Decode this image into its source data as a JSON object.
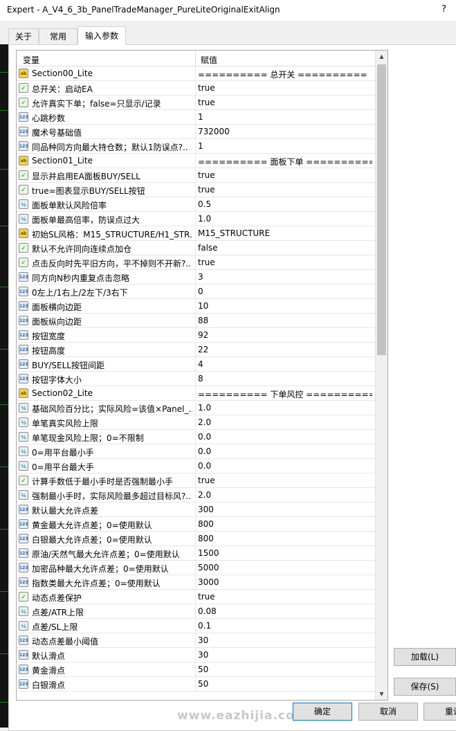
{
  "window": {
    "title": "Expert - A_V4_6_3b_PanelTradeManager_PureLiteOriginalExitAlign",
    "help": "?"
  },
  "tabs": [
    {
      "label": "关于"
    },
    {
      "label": "常用"
    },
    {
      "label": "输入参数",
      "active": true
    }
  ],
  "grid": {
    "col_variable": "变量",
    "col_value": "赋值",
    "rows": [
      {
        "type": "string",
        "icon": "ab",
        "name": "Section00_Lite",
        "value": "========== 总开关 =========="
      },
      {
        "type": "bool",
        "icon": "✓",
        "name": "总开关：启动EA",
        "value": "true"
      },
      {
        "type": "bool",
        "icon": "✓",
        "name": "允许真实下单；false=只显示/记录",
        "value": "true"
      },
      {
        "type": "int",
        "icon": "123",
        "name": "心跳秒数",
        "value": "1"
      },
      {
        "type": "int",
        "icon": "123",
        "name": "魔术号基础值",
        "value": "732000"
      },
      {
        "type": "int",
        "icon": "123",
        "name": "同品种同方向最大持仓数；默认1防误点?..",
        "value": "1"
      },
      {
        "type": "string",
        "icon": "ab",
        "name": "Section01_Lite",
        "value": "========== 面板下单 =========="
      },
      {
        "type": "bool",
        "icon": "✓",
        "name": "显示并启用EA面板BUY/SELL",
        "value": "true"
      },
      {
        "type": "bool",
        "icon": "✓",
        "name": "true=图表显示BUY/SELL按钮",
        "value": "true"
      },
      {
        "type": "double",
        "icon": "½",
        "name": "面板单默认风险倍率",
        "value": "0.5"
      },
      {
        "type": "double",
        "icon": "½",
        "name": "面板单最高倍率，防误点过大",
        "value": "1.0"
      },
      {
        "type": "string",
        "icon": "ab",
        "name": "初始SL风格：M15_STRUCTURE/H1_STR...",
        "value": "M15_STRUCTURE"
      },
      {
        "type": "bool",
        "icon": "✓",
        "name": "默认不允许同向连续点加仓",
        "value": "false"
      },
      {
        "type": "bool",
        "icon": "✓",
        "name": "点击反向时先平旧方向，平不掉则不开新?..",
        "value": "true"
      },
      {
        "type": "int",
        "icon": "123",
        "name": "同方向N秒内重复点击忽略",
        "value": "3"
      },
      {
        "type": "int",
        "icon": "123",
        "name": "0左上/1右上/2左下/3右下",
        "value": "0"
      },
      {
        "type": "int",
        "icon": "123",
        "name": "面板横向边距",
        "value": "10"
      },
      {
        "type": "int",
        "icon": "123",
        "name": "面板纵向边距",
        "value": "88"
      },
      {
        "type": "int",
        "icon": "123",
        "name": "按钮宽度",
        "value": "92"
      },
      {
        "type": "int",
        "icon": "123",
        "name": "按钮高度",
        "value": "22"
      },
      {
        "type": "int",
        "icon": "123",
        "name": "BUY/SELL按钮间距",
        "value": "4"
      },
      {
        "type": "int",
        "icon": "123",
        "name": "按钮字体大小",
        "value": "8"
      },
      {
        "type": "string",
        "icon": "ab",
        "name": "Section02_Lite",
        "value": "========== 下单风控 =========="
      },
      {
        "type": "double",
        "icon": "½",
        "name": "基础风险百分比；实际风险=该值×Panel_...",
        "value": "1.0"
      },
      {
        "type": "double",
        "icon": "½",
        "name": "单笔真实风险上限",
        "value": "2.0"
      },
      {
        "type": "double",
        "icon": "½",
        "name": "单笔现金风险上限；0=不限制",
        "value": "0.0"
      },
      {
        "type": "double",
        "icon": "½",
        "name": "0=用平台最小手",
        "value": "0.0"
      },
      {
        "type": "double",
        "icon": "½",
        "name": "0=用平台最大手",
        "value": "0.0"
      },
      {
        "type": "bool",
        "icon": "✓",
        "name": "计算手数低于最小手时是否强制最小手",
        "value": "true"
      },
      {
        "type": "double",
        "icon": "½",
        "name": "强制最小手时，实际风险最多超过目标风?..",
        "value": "2.0"
      },
      {
        "type": "int",
        "icon": "123",
        "name": "默认最大允许点差",
        "value": "300"
      },
      {
        "type": "int",
        "icon": "123",
        "name": "黄金最大允许点差；0=使用默认",
        "value": "800"
      },
      {
        "type": "int",
        "icon": "123",
        "name": "白银最大允许点差；0=使用默认",
        "value": "800"
      },
      {
        "type": "int",
        "icon": "123",
        "name": "原油/天然气最大允许点差；0=使用默认",
        "value": "1500"
      },
      {
        "type": "int",
        "icon": "123",
        "name": "加密品种最大允许点差；0=使用默认",
        "value": "5000"
      },
      {
        "type": "int",
        "icon": "123",
        "name": "指数类最大允许点差；0=使用默认",
        "value": "3000"
      },
      {
        "type": "bool",
        "icon": "✓",
        "name": "动态点差保护",
        "value": "true"
      },
      {
        "type": "double",
        "icon": "½",
        "name": "点差/ATR上限",
        "value": "0.08"
      },
      {
        "type": "double",
        "icon": "½",
        "name": "点差/SL上限",
        "value": "0.1"
      },
      {
        "type": "int",
        "icon": "123",
        "name": "动态点差最小阈值",
        "value": "30"
      },
      {
        "type": "int",
        "icon": "123",
        "name": "默认滑点",
        "value": "30"
      },
      {
        "type": "int",
        "icon": "123",
        "name": "黄金滑点",
        "value": "50"
      },
      {
        "type": "int",
        "icon": "123",
        "name": "白银滑点",
        "value": "50"
      }
    ]
  },
  "buttons": {
    "load": "加载(L)",
    "save": "保存(S)",
    "ok": "确定",
    "cancel": "取消",
    "reset": "重设"
  },
  "watermark": "www.eazhijia.com"
}
